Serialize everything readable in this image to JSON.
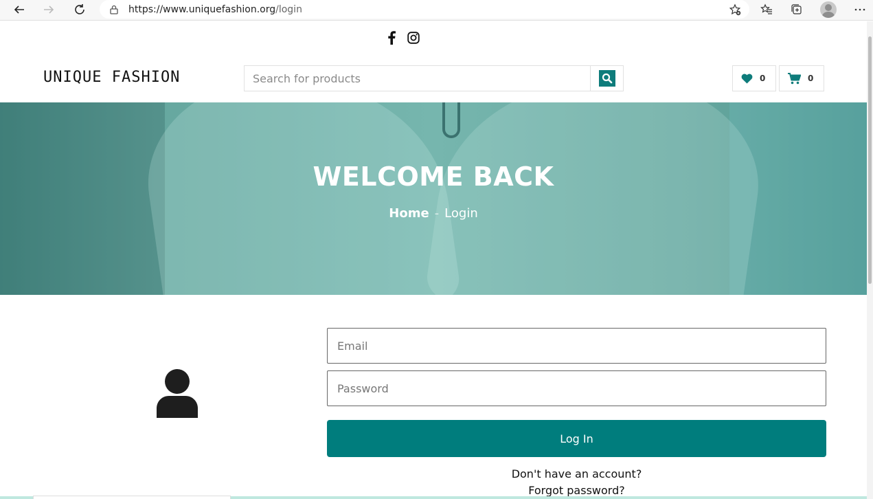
{
  "browser": {
    "url_host": "https://www.uniquefashion.org",
    "url_path": "/login"
  },
  "header": {
    "logo": "UNIQUE FASHION",
    "search_placeholder": "Search for products",
    "wishlist_count": "0",
    "cart_count": "0"
  },
  "hero": {
    "title": "WELCOME BACK",
    "breadcrumb_home": "Home",
    "breadcrumb_current": "Login"
  },
  "login": {
    "email_placeholder": "Email",
    "password_placeholder": "Password",
    "button_label": "Log In",
    "signup_link": "Don't have an account?",
    "forgot_link": "Forgot password?"
  },
  "colors": {
    "accent": "#007d7d",
    "hero_tint": "#66a79f"
  },
  "icons": [
    "back-icon",
    "forward-icon",
    "reload-icon",
    "lock-icon",
    "favorite-add-icon",
    "favorites-icon",
    "collections-icon",
    "profile-icon",
    "more-icon",
    "facebook-icon",
    "instagram-icon",
    "search-icon",
    "heart-icon",
    "cart-icon",
    "user-icon"
  ]
}
